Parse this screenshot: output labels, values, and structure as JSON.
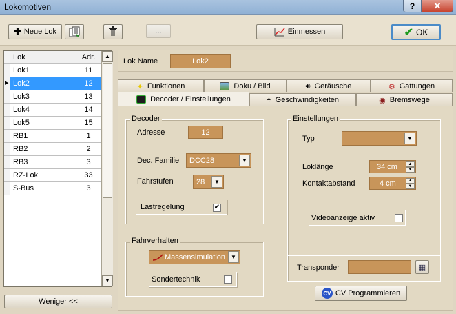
{
  "window": {
    "title": "Lokomotiven",
    "help": "?",
    "close": "✕"
  },
  "toolbar": {
    "new_lok": "Neue Lok",
    "disabled_btn": "...",
    "einmessen": "Einmessen",
    "ok": "OK"
  },
  "list": {
    "headers": [
      "Lok",
      "Adr."
    ],
    "rows": [
      {
        "name": "Lok1",
        "adr": "11"
      },
      {
        "name": "Lok2",
        "adr": "12"
      },
      {
        "name": "Lok3",
        "adr": "13"
      },
      {
        "name": "Lok4",
        "adr": "14"
      },
      {
        "name": "Lok5",
        "adr": "15"
      },
      {
        "name": "RB1",
        "adr": "1"
      },
      {
        "name": "RB2",
        "adr": "2"
      },
      {
        "name": "RB3",
        "adr": "3"
      },
      {
        "name": "RZ-Lok",
        "adr": "33"
      },
      {
        "name": "S-Bus",
        "adr": "3"
      }
    ],
    "selected_index": 1,
    "less_button": "Weniger <<"
  },
  "lokname": {
    "label": "Lok Name",
    "value": "Lok2"
  },
  "tabs": {
    "row1": [
      "Funktionen",
      "Doku / Bild",
      "Geräusche",
      "Gattungen"
    ],
    "row2": [
      "Decoder / Einstellungen",
      "Geschwindigkeiten",
      "Bremswege"
    ],
    "active": "Decoder / Einstellungen"
  },
  "decoder": {
    "title": "Decoder",
    "adresse_label": "Adresse",
    "adresse_value": "12",
    "familie_label": "Dec. Familie",
    "familie_value": "DCC28",
    "fahrstufen_label": "Fahrstufen",
    "fahrstufen_value": "28",
    "lastregelung_label": "Lastregelung",
    "lastregelung_checked": "✔"
  },
  "fahrverhalten": {
    "title": "Fahrverhalten",
    "value": "Massensimulation",
    "sondertechnik_label": "Sondertechnik"
  },
  "einstellungen": {
    "title": "Einstellungen",
    "typ_label": "Typ",
    "typ_value": "",
    "loklaenge_label": "Loklänge",
    "loklaenge_value": "34 cm",
    "kontakt_label": "Kontaktabstand",
    "kontakt_value": "4 cm",
    "video_label": "Videoanzeige aktiv",
    "transponder_label": "Transponder",
    "transponder_value": ""
  },
  "cv": {
    "button": "CV Programmieren",
    "icon_text": "CV"
  }
}
